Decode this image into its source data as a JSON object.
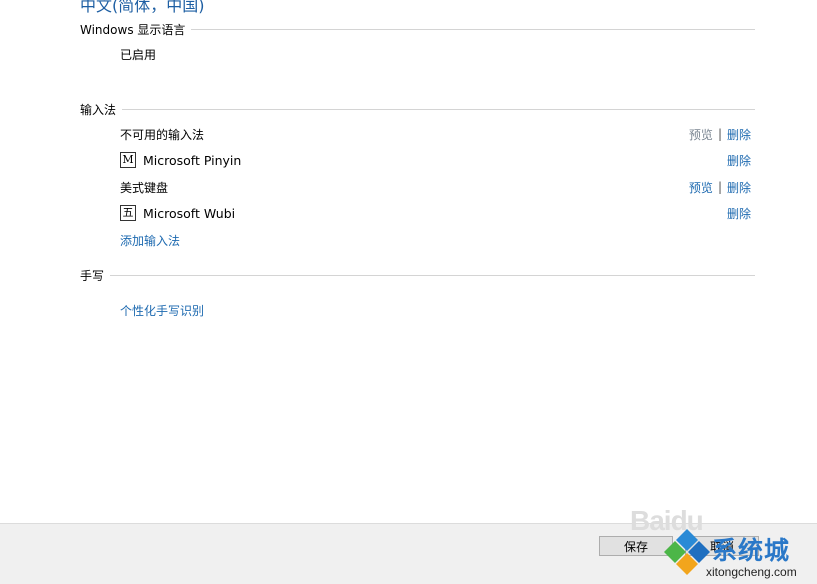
{
  "title": "中文(简体，中国)",
  "display_language": {
    "heading": "Windows 显示语言",
    "status": "已启用"
  },
  "input_methods": {
    "heading": "输入法",
    "items": [
      {
        "label": "不可用的输入法",
        "preview": "预览",
        "sep": "|",
        "delete": "删除"
      },
      {
        "icon": "M",
        "label": "Microsoft Pinyin",
        "delete": "删除"
      },
      {
        "label": "美式键盘",
        "preview": "预览",
        "sep": "|",
        "delete": "删除"
      },
      {
        "icon": "五",
        "label": "Microsoft Wubi",
        "delete": "删除"
      }
    ],
    "add_link": "添加输入法"
  },
  "handwriting": {
    "heading": "手写",
    "personalize_link": "个性化手写识别"
  },
  "footer": {
    "save_label": "保存",
    "cancel_label": "取消"
  },
  "watermark": {
    "baidu": "Baidu",
    "brand": "系统城",
    "url": "xitongcheng.com"
  },
  "colors": {
    "accent": "#1e6ab0",
    "title": "#1e5fa3",
    "footer_bg": "#f0f0f0"
  }
}
